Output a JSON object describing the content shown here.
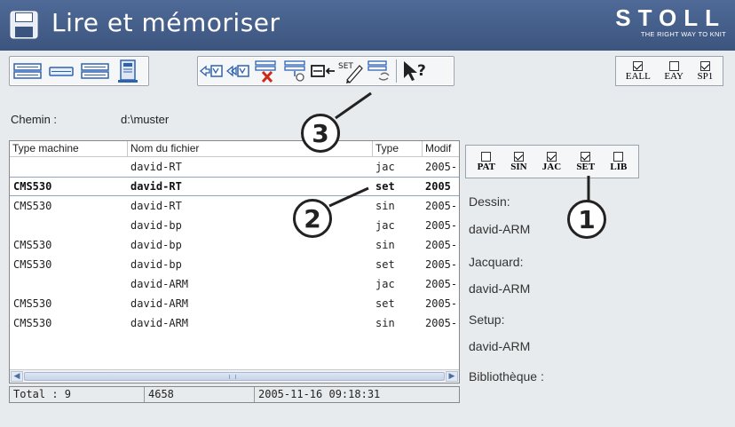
{
  "window": {
    "title": "Lire et mémoriser"
  },
  "brand": {
    "name": "STOLL",
    "tagline": "THE RIGHT WAY TO KNIT"
  },
  "toolbar_right": [
    {
      "label": "EALL",
      "checked": true
    },
    {
      "label": "EAY",
      "checked": false
    },
    {
      "label": "SP1",
      "checked": true
    }
  ],
  "path": {
    "label": "Chemin :",
    "value": "d:\\muster"
  },
  "table": {
    "columns": [
      "Type machine",
      "Nom du fichier",
      "Type",
      "Modif"
    ],
    "rows": [
      {
        "machine": "",
        "file": "david-RT",
        "type": "jac",
        "modified": "2005-",
        "selected": false
      },
      {
        "machine": "CMS530",
        "file": "david-RT",
        "type": "set",
        "modified": "2005",
        "selected": true
      },
      {
        "machine": "CMS530",
        "file": "david-RT",
        "type": "sin",
        "modified": "2005-",
        "selected": false
      },
      {
        "machine": "",
        "file": "david-bp",
        "type": "jac",
        "modified": "2005-",
        "selected": false
      },
      {
        "machine": "CMS530",
        "file": "david-bp",
        "type": "sin",
        "modified": "2005-",
        "selected": false
      },
      {
        "machine": "CMS530",
        "file": "david-bp",
        "type": "set",
        "modified": "2005-",
        "selected": false
      },
      {
        "machine": "",
        "file": "david-ARM",
        "type": "jac",
        "modified": "2005-",
        "selected": false
      },
      {
        "machine": "CMS530",
        "file": "david-ARM",
        "type": "set",
        "modified": "2005-",
        "selected": false
      },
      {
        "machine": "CMS530",
        "file": "david-ARM",
        "type": "sin",
        "modified": "2005-",
        "selected": false
      }
    ]
  },
  "status": {
    "total": "Total : 9",
    "size": "4658",
    "datetime": "2005-11-16 09:18:31"
  },
  "filters": [
    {
      "label": "PAT",
      "checked": false
    },
    {
      "label": "SIN",
      "checked": true
    },
    {
      "label": "JAC",
      "checked": true
    },
    {
      "label": "SET",
      "checked": true
    },
    {
      "label": "LIB",
      "checked": false
    }
  ],
  "details": {
    "dessin_label": "Dessin:",
    "dessin_value": "david-ARM",
    "jacquard_label": "Jacquard:",
    "jacquard_value": "david-ARM",
    "setup_label": "Setup:",
    "setup_value": "david-ARM",
    "bibliotheque_label": "Bibliothèque :"
  },
  "callouts": [
    "3",
    "2",
    "1"
  ],
  "toolbar_icons": {
    "set_text": "SET",
    "help_text": "?"
  },
  "colors": {
    "titlebar": "#42598a",
    "accent": "#2d62b3",
    "delete_red": "#cc2a1a"
  }
}
